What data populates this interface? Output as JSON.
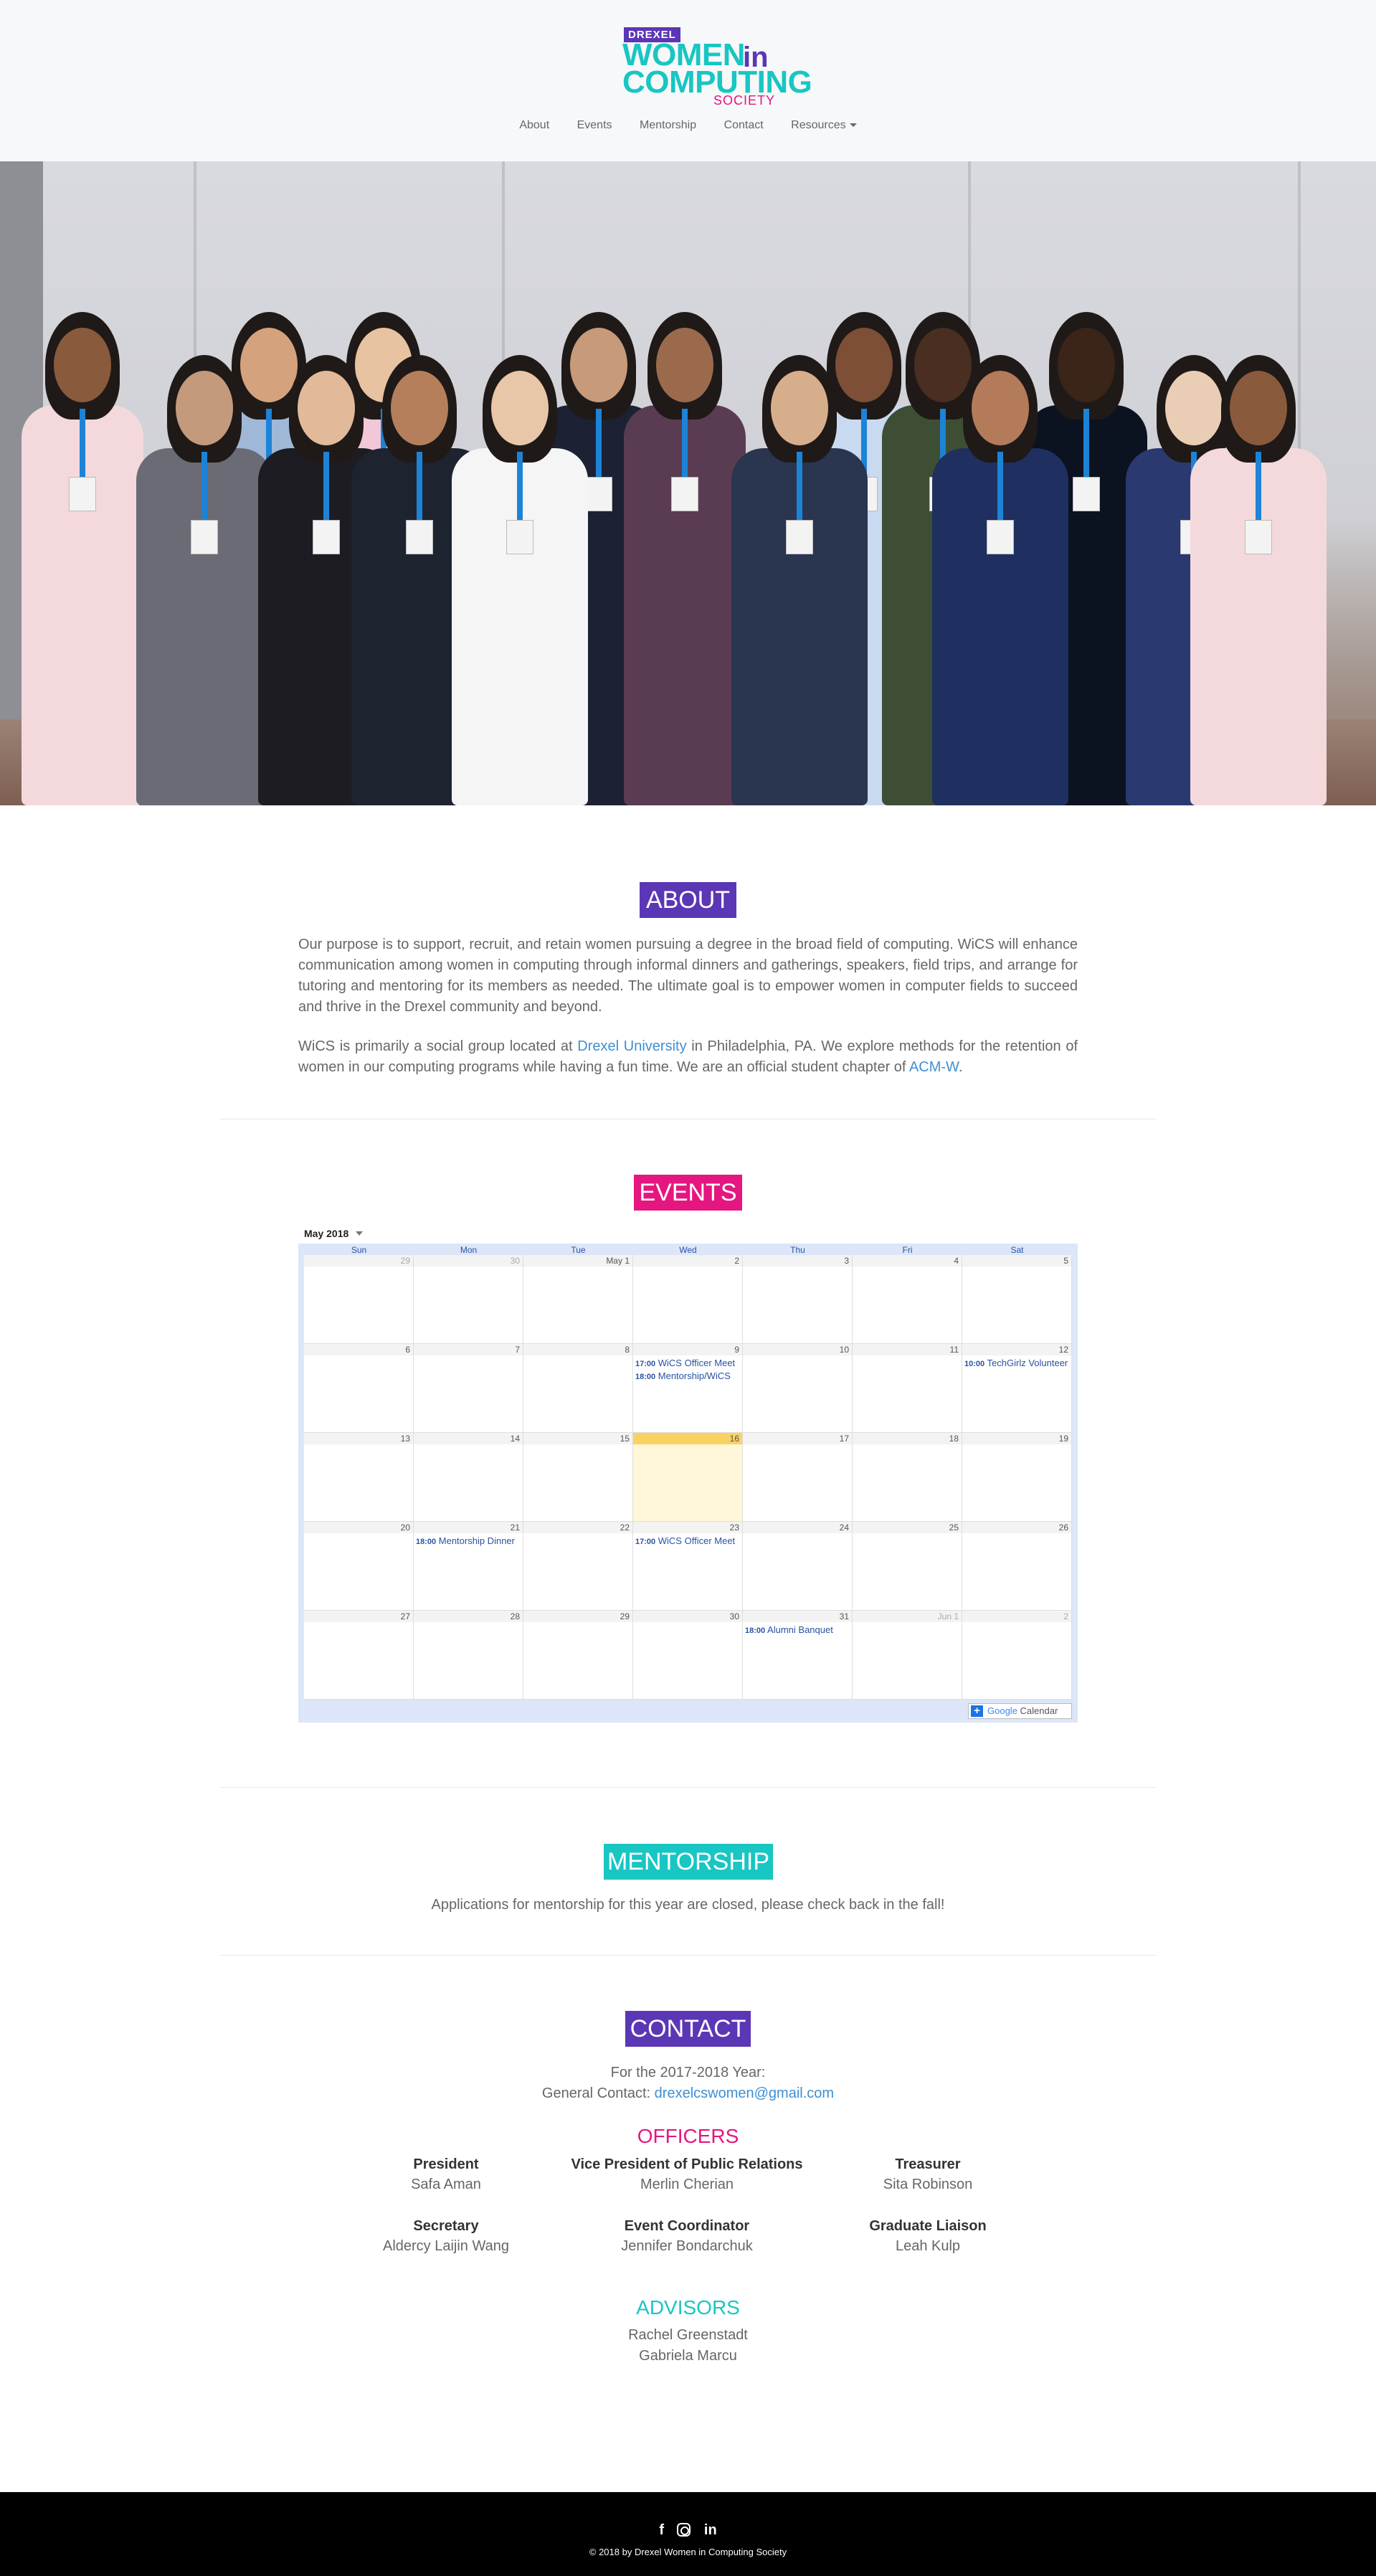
{
  "brand": {
    "drexel": "DREXEL",
    "women": "WOMEN",
    "in": "in",
    "computing": "COMPUTING",
    "society": "SOCIETY"
  },
  "nav": {
    "about": "About",
    "events": "Events",
    "mentorship": "Mentorship",
    "contact": "Contact",
    "resources": "Resources"
  },
  "colors": {
    "purple": "#5b36b5",
    "pink": "#e5167f",
    "teal": "#18c6c3",
    "link": "#3f8fd2"
  },
  "about": {
    "title": "ABOUT",
    "p1": "Our purpose is to support, recruit, and retain women pursuing a degree in the broad field of computing. WiCS will enhance communication among women in computing through informal dinners and gatherings, speakers, field trips, and arrange for tutoring and mentoring for its members as needed. The ultimate goal is to empower women in computer fields to succeed and thrive in the Drexel community and beyond.",
    "p2_a": "WiCS is primarily a social group located at ",
    "p2_link1": "Drexel University",
    "p2_b": " in Philadelphia, PA. We explore methods for the retention of women in our computing programs while having a fun time. We are an official student chapter of ",
    "p2_link2": "ACM-W",
    "p2_c": "."
  },
  "events": {
    "title": "EVENTS",
    "month": "May 2018",
    "weekdays": [
      "Sun",
      "Mon",
      "Tue",
      "Wed",
      "Thu",
      "Fri",
      "Sat"
    ],
    "cells": [
      "29",
      "30",
      "May 1",
      "2",
      "3",
      "4",
      "5",
      "6",
      "7",
      "8",
      "9",
      "10",
      "11",
      "12",
      "13",
      "14",
      "15",
      "16",
      "17",
      "18",
      "19",
      "20",
      "21",
      "22",
      "23",
      "24",
      "25",
      "26",
      "27",
      "28",
      "29",
      "30",
      "31",
      "Jun 1",
      "2"
    ],
    "ev_9a_time": "17:00",
    "ev_9a": "WiCS Officer Meet",
    "ev_9b_time": "18:00",
    "ev_9b": "Mentorship/WiCS ",
    "ev_12_time": "10:00",
    "ev_12": "TechGirlz Volunteer",
    "ev_21_time": "18:00",
    "ev_21": "Mentorship Dinner",
    "ev_23_time": "17:00",
    "ev_23": "WiCS Officer Meet",
    "ev_31_time": "18:00",
    "ev_31": "Alumni Banquet",
    "gcal_google": "Google",
    "gcal_cal": " Calendar"
  },
  "mentorship": {
    "title": "MENTORSHIP",
    "text": "Applications for mentorship for this year are closed, please check back in the fall!"
  },
  "contact": {
    "title": "CONTACT",
    "year": "For the 2017-2018 Year:",
    "general_label": "General Contact: ",
    "email": "drexelcswomen@gmail.com",
    "officers_title": "OFFICERS",
    "officers": [
      {
        "role": "President",
        "name": "Safa Aman"
      },
      {
        "role": "Vice President of Public Relations",
        "name": "Merlin Cherian"
      },
      {
        "role": "Treasurer",
        "name": "Sita Robinson"
      },
      {
        "role": "Secretary",
        "name": "Aldercy Laijin Wang"
      },
      {
        "role": "Event Coordinator",
        "name": "Jennifer Bondarchuk"
      },
      {
        "role": "Graduate Liaison",
        "name": "Leah Kulp"
      }
    ],
    "advisors_title": "ADVISORS",
    "advisors": [
      "Rachel Greenstadt",
      "Gabriela Marcu"
    ]
  },
  "footer": {
    "facebook": "f",
    "linkedin": "in",
    "copyright": "© 2018 by Drexel Women in Computing Society"
  }
}
